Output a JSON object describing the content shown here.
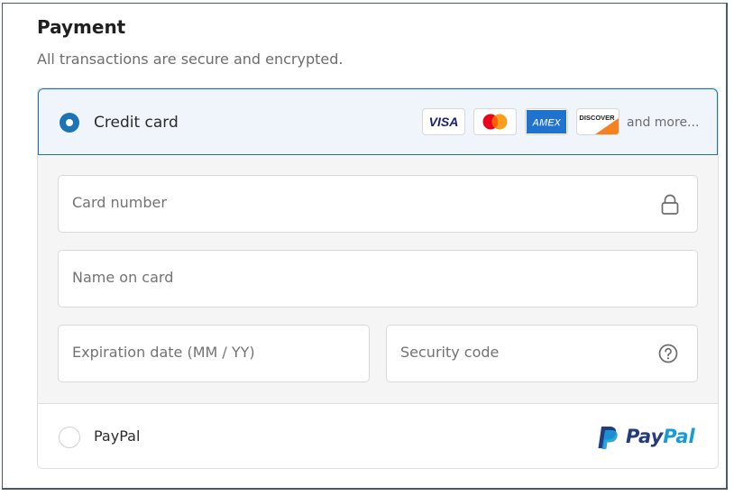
{
  "header": {
    "title": "Payment",
    "subtitle": "All transactions are secure and encrypted."
  },
  "credit_card": {
    "label": "Credit card",
    "selected": true,
    "brands": [
      "VISA",
      "Mastercard",
      "AMEX",
      "DISCOVER"
    ],
    "more_label": "and more...",
    "fields": {
      "card_number_placeholder": "Card number",
      "name_placeholder": "Name on card",
      "expiration_placeholder": "Expiration date (MM / YY)",
      "security_placeholder": "Security code"
    }
  },
  "paypal": {
    "label": "PayPal",
    "selected": false,
    "logo_part1": "Pay",
    "logo_part2": "Pal"
  },
  "colors": {
    "accent": "#1d74b5",
    "paypal_dark": "#253b80",
    "paypal_light": "#179bd7"
  },
  "icons": [
    "radio-selected-icon",
    "lock-icon",
    "help-circle-icon",
    "paypal-logo-icon"
  ]
}
